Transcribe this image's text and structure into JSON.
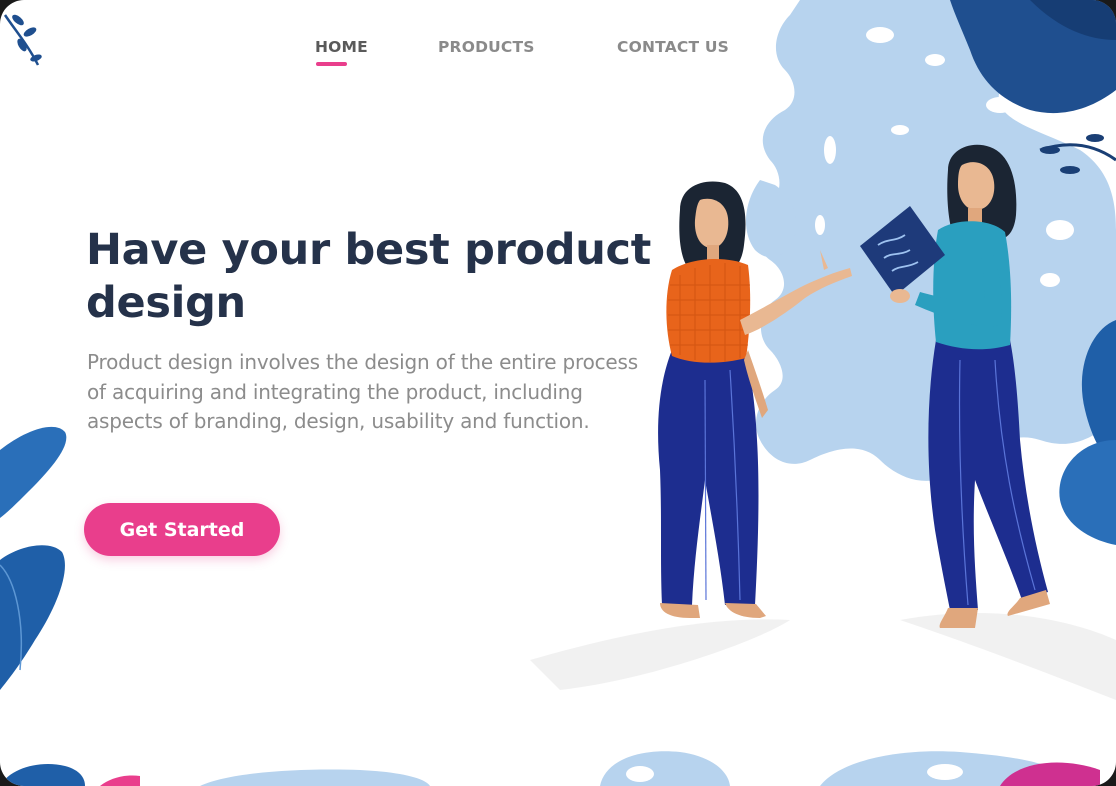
{
  "nav": {
    "items": [
      {
        "label": "HOME",
        "active": true
      },
      {
        "label": "PRODUCTS",
        "active": false
      },
      {
        "label": "CONTACT US",
        "active": false
      }
    ]
  },
  "hero": {
    "title": "Have your best product design",
    "description": "Product design involves the design of the entire process of acquiring and integrating the product, including aspects of branding, design, usability and function.",
    "cta_label": "Get Started"
  },
  "colors": {
    "accent": "#e93e8c",
    "heading": "#25324a",
    "body_text": "#8c8c8c",
    "nav_text": "#8a8a8a",
    "blob_blue": "#b7d3ee",
    "leaf_blue": "#1f5fa8",
    "pants_blue": "#1d2d8f",
    "shirt_orange": "#e8641b",
    "shirt_teal": "#2a9fbf"
  },
  "illustration": {
    "subjects": [
      "woman-pointing",
      "woman-holding-notebook"
    ]
  }
}
